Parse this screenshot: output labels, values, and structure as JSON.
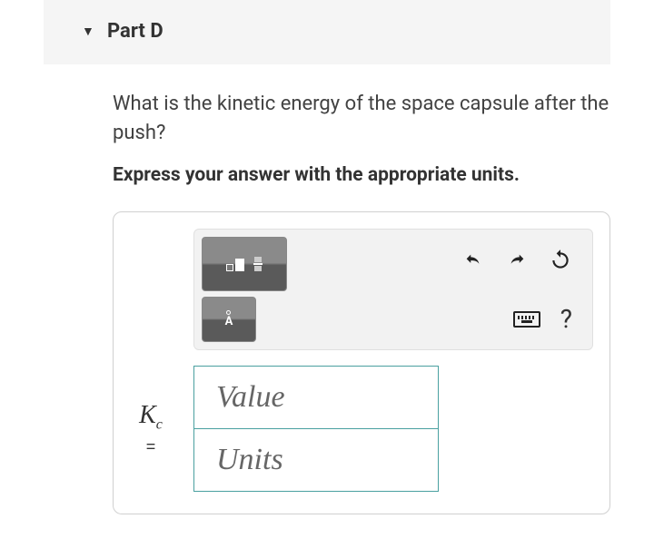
{
  "part": {
    "label": "Part D"
  },
  "question": "What is the kinetic energy of the space capsule after the push?",
  "instruction": "Express your answer with the appropriate units.",
  "toolbar": {
    "templates_tooltip": "Templates",
    "symbols_tooltip": "Symbols",
    "undo_tooltip": "Undo",
    "redo_tooltip": "Redo",
    "reset_tooltip": "Reset",
    "keyboard_tooltip": "Keyboard shortcuts",
    "help_label": "?"
  },
  "answer": {
    "variable_base": "K",
    "variable_subscript": "c",
    "equals": "=",
    "value_placeholder": "Value",
    "units_placeholder": "Units"
  }
}
